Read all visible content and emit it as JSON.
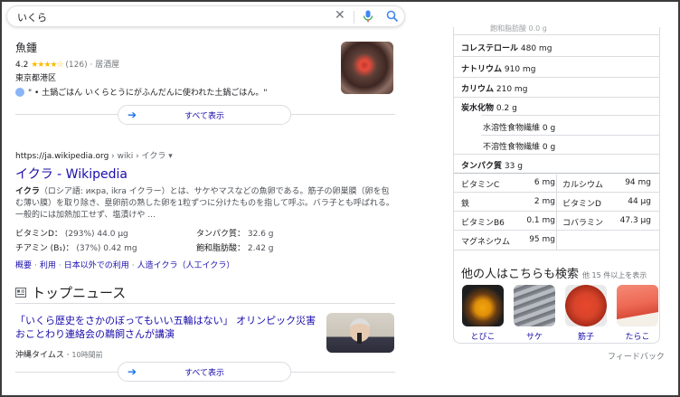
{
  "search": {
    "query": "いくら"
  },
  "local": {
    "name": "魚鍾",
    "rating": "4.2",
    "stars": "★★★★☆",
    "count": "(126)",
    "sep": " · ",
    "category": "居酒屋",
    "area": "東京都港区",
    "review": "\" • 土鍋ごはん いくらとうにがふんだんに使われた土鍋ごはん。\""
  },
  "show_all_1": "すべて表示",
  "wiki": {
    "crumb_domain": "https://ja.wikipedia.org",
    "crumb_path": " › wiki › イクラ ▾",
    "title": "イクラ - Wikipedia",
    "snippet_bold": "イクラ",
    "snippet": "（ロシア語: икра, ikra イクラー）とは、サケやマスなどの魚卵である。筋子の卵巣膜（卵を包む薄い膜）を取り除き、塁卵前の熟した卵を1粒ずつに分けたものを指して呼ぶ。バラ子とも呼ばれる。一般的には加熱加工せず、塩漬けや ...",
    "facts": [
      {
        "k": "ビタミンD：",
        "v": "(293%) 44.0 μg"
      },
      {
        "k": "タンパク質：",
        "v": "32.6 g"
      },
      {
        "k": "チアミン (B₁)：",
        "v": "(37%) 0.42 mg"
      },
      {
        "k": "飽和脂肪酸：",
        "v": "2.42 g"
      }
    ],
    "links": [
      "概要",
      "利用",
      "日本以外での利用",
      "人造イクラ（人工イクラ）"
    ]
  },
  "news": {
    "heading": "トップニュース",
    "title": "「いくら歴史をさかのぼってもいい五輪はない」 オリンピック災害おことわり連絡会の鵜飼さんが講演",
    "source": "沖縄タイムス",
    "ago": "10時間前"
  },
  "show_all_2": "すべて表示",
  "nutrition": {
    "top_partial": "飽和脂肪酸 0.0 g",
    "rows": [
      {
        "k": "コレステロール",
        "v": "480 mg",
        "indent": false
      },
      {
        "k": "ナトリウム",
        "v": "910 mg",
        "indent": false
      },
      {
        "k": "カリウム",
        "v": "210 mg",
        "indent": false
      },
      {
        "k": "炭水化物",
        "v": "0.2 g",
        "indent": false
      },
      {
        "k": "水溶性食物繊維",
        "v": "0 g",
        "indent": true
      },
      {
        "k": "不溶性食物繊維",
        "v": "0 g",
        "indent": true
      },
      {
        "k": "タンパク質",
        "v": "33 g",
        "indent": false
      }
    ],
    "vitamins": [
      [
        "ビタミンC",
        "6 mg",
        "カルシウム",
        "94 mg"
      ],
      [
        "鉄",
        "2 mg",
        "ビタミンD",
        "44 μg"
      ],
      [
        "ビタミンB6",
        "0.1 mg",
        "コバラミン",
        "47.3 μg"
      ],
      [
        "マグネシウム",
        "95 mg",
        "",
        ""
      ]
    ]
  },
  "others": {
    "heading": "他の人はこちらも検索",
    "more": "他 15 件以上を表示",
    "items": [
      {
        "label": "とびこ",
        "color": "#e8a020"
      },
      {
        "label": "サケ",
        "color": "#8a8f96"
      },
      {
        "label": "筋子",
        "color": "#d8442a"
      },
      {
        "label": "たらこ",
        "color": "#ee6a55"
      }
    ]
  },
  "feedback": "フィードバック"
}
